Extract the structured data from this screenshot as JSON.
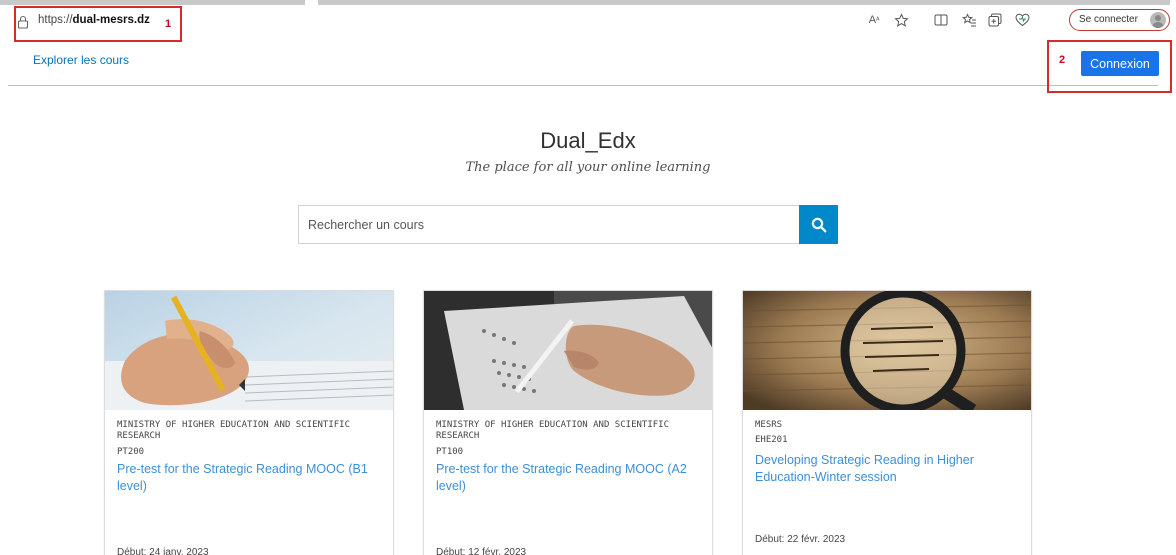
{
  "browser": {
    "url_prefix": "https://",
    "url_domain": "dual-mesrs.dz",
    "signin_label": "Se connecter",
    "annotation_1": "1",
    "annotation_2": "2",
    "annotation_color": "#d42b2b"
  },
  "header": {
    "explore_link": "Explorer les cours",
    "login_button": "Connexion",
    "accent_color": "#1a73e8"
  },
  "hero": {
    "title": "Dual_Edx",
    "subtitle": "The place for all your online learning"
  },
  "search": {
    "placeholder": "Rechercher un cours",
    "button_icon": "search-icon",
    "button_color": "#0088c9"
  },
  "courses": [
    {
      "org": "MINISTRY OF HIGHER EDUCATION AND SCIENTIFIC RESEARCH",
      "code": "PT200",
      "title": "Pre-test for the Strategic Reading MOOC (B1 level)",
      "start": "Début: 24 janv. 2023",
      "image": "hand-writing-with-pencil"
    },
    {
      "org": "MINISTRY OF HIGHER EDUCATION AND SCIENTIFIC RESEARCH",
      "code": "PT100",
      "title": "Pre-test for the Strategic Reading MOOC (A2 level)",
      "start": "Début: 12 févr. 2023",
      "image": "hand-filling-answer-sheet"
    },
    {
      "org": "MESRS",
      "code": "EHE201",
      "title": "Developing Strategic Reading in Higher Education-Winter session",
      "start": "Début: 22 févr. 2023",
      "image": "magnifying-glass-over-text"
    }
  ]
}
